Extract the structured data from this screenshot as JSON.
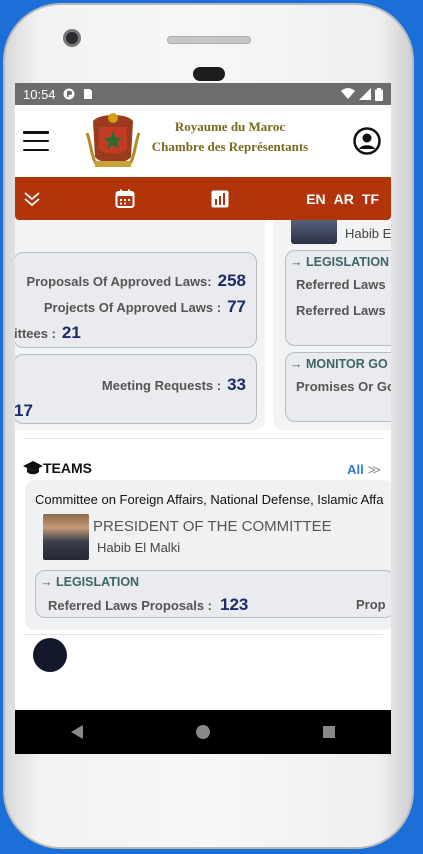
{
  "status": {
    "time": "10:54"
  },
  "header": {
    "title_line1": "Royaume du Maroc",
    "title_line2": "Chambre des Représentants"
  },
  "nav": {
    "lang_en": "EN",
    "lang_ar": "AR",
    "lang_tf": "TF"
  },
  "stats_card": {
    "proposals_label": "Proposals Of Approved Laws:",
    "proposals_value": "258",
    "projects_label": "Projects Of Approved Laws :",
    "projects_value": "77",
    "committees_label": "ittees :",
    "committees_value": "21",
    "meeting_label": "Meeting Requests :",
    "meeting_value": "33",
    "partial_value": "17"
  },
  "side_card": {
    "name_partial": "Habib E",
    "legislation_head": "LEGISLATION",
    "referred_laws_1": "Referred Laws",
    "referred_laws_2": "Referred Laws",
    "monitor_head": "MONITOR GO",
    "promises_label": "Promises Or Go"
  },
  "teams": {
    "heading": "TEAMS",
    "all_label": "All",
    "committee_name": "Committee on Foreign Affairs, National Defense, Islamic Affa",
    "role": "PRESIDENT OF THE COMMITTEE",
    "president_name": "Habib El Malki",
    "legislation_head": "LEGISLATION",
    "referred_label": "Referred Laws Proposals :",
    "referred_value": "123",
    "partial_label": "Prop"
  },
  "icons": {
    "hamburger": "menu-icon",
    "user": "user-circle-icon",
    "collapse": "double-chevron-down-icon",
    "calendar": "calendar-icon",
    "chart": "bar-chart-icon",
    "teams": "graduation-cap-icon",
    "moon": "moon-icon"
  },
  "colors": {
    "navbar": "#b1340a",
    "title_gold": "#7a6a1b",
    "number_navy": "#1b2a6b",
    "section_teal": "#3c6467",
    "link_blue": "#2a7ad6"
  }
}
